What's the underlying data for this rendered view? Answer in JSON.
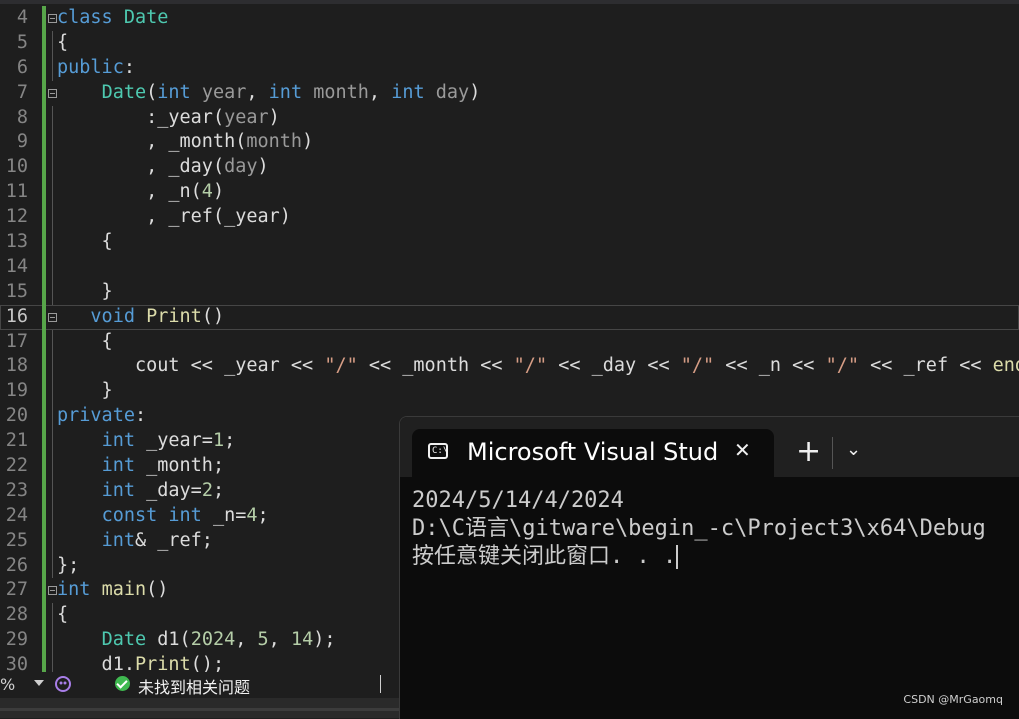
{
  "editor": {
    "active_line": "16",
    "lines": [
      {
        "n": "4",
        "tokens": [
          [
            "kw",
            "class "
          ],
          [
            "ty",
            "Date"
          ]
        ]
      },
      {
        "n": "5",
        "tokens": [
          [
            "pl",
            "{"
          ]
        ]
      },
      {
        "n": "6",
        "tokens": [
          [
            "kw",
            "public"
          ],
          [
            "pl",
            ":"
          ]
        ]
      },
      {
        "n": "7",
        "tokens": [
          [
            "pl",
            "    "
          ],
          [
            "ty",
            "Date"
          ],
          [
            "pl",
            "("
          ],
          [
            "kw",
            "int"
          ],
          [
            "pm",
            " year"
          ],
          [
            "pl",
            ", "
          ],
          [
            "kw",
            "int"
          ],
          [
            "pm",
            " month"
          ],
          [
            "pl",
            ", "
          ],
          [
            "kw",
            "int"
          ],
          [
            "pm",
            " day"
          ],
          [
            "pl",
            ")"
          ]
        ]
      },
      {
        "n": "8",
        "tokens": [
          [
            "pl",
            "        :_year"
          ],
          [
            "pl",
            "("
          ],
          [
            "pm",
            "year"
          ],
          [
            "pl",
            ")"
          ]
        ]
      },
      {
        "n": "9",
        "tokens": [
          [
            "pl",
            "        , _month"
          ],
          [
            "pl",
            "("
          ],
          [
            "pm",
            "month"
          ],
          [
            "pl",
            ")"
          ]
        ]
      },
      {
        "n": "10",
        "tokens": [
          [
            "pl",
            "        , _day"
          ],
          [
            "pl",
            "("
          ],
          [
            "pm",
            "day"
          ],
          [
            "pl",
            ")"
          ]
        ]
      },
      {
        "n": "11",
        "tokens": [
          [
            "pl",
            "        , _n"
          ],
          [
            "pl",
            "("
          ],
          [
            "nu",
            "4"
          ],
          [
            "pl",
            ")"
          ]
        ]
      },
      {
        "n": "12",
        "tokens": [
          [
            "pl",
            "        , _ref"
          ],
          [
            "pl",
            "(_year)"
          ]
        ]
      },
      {
        "n": "13",
        "tokens": [
          [
            "pl",
            "    {"
          ]
        ]
      },
      {
        "n": "14",
        "tokens": [
          [
            "pl",
            ""
          ]
        ]
      },
      {
        "n": "15",
        "tokens": [
          [
            "pl",
            "    }"
          ]
        ]
      },
      {
        "n": "16",
        "tokens": [
          [
            "pl",
            "   "
          ],
          [
            "kw",
            "void"
          ],
          [
            "pl",
            " "
          ],
          [
            "fn",
            "Print"
          ],
          [
            "pl",
            "()"
          ]
        ]
      },
      {
        "n": "17",
        "tokens": [
          [
            "pl",
            "    {"
          ]
        ]
      },
      {
        "n": "18",
        "tokens": [
          [
            "pl",
            "       cout << _year << "
          ],
          [
            "st",
            "\"/\""
          ],
          [
            "pl",
            " << _month << "
          ],
          [
            "st",
            "\"/\""
          ],
          [
            "pl",
            " << _day << "
          ],
          [
            "st",
            "\"/\""
          ],
          [
            "pl",
            " << _n << "
          ],
          [
            "st",
            "\"/\""
          ],
          [
            "pl",
            " << _ref << "
          ],
          [
            "fn",
            "endl"
          ],
          [
            "pl",
            ";"
          ]
        ]
      },
      {
        "n": "19",
        "tokens": [
          [
            "pl",
            "    }"
          ]
        ]
      },
      {
        "n": "20",
        "tokens": [
          [
            "kw",
            "private"
          ],
          [
            "pl",
            ":"
          ]
        ]
      },
      {
        "n": "21",
        "tokens": [
          [
            "pl",
            "    "
          ],
          [
            "kw",
            "int"
          ],
          [
            "pl",
            " _year="
          ],
          [
            "nu",
            "1"
          ],
          [
            "pl",
            ";"
          ]
        ]
      },
      {
        "n": "22",
        "tokens": [
          [
            "pl",
            "    "
          ],
          [
            "kw",
            "int"
          ],
          [
            "pl",
            " _month;"
          ]
        ]
      },
      {
        "n": "23",
        "tokens": [
          [
            "pl",
            "    "
          ],
          [
            "kw",
            "int"
          ],
          [
            "pl",
            " _day="
          ],
          [
            "nu",
            "2"
          ],
          [
            "pl",
            ";"
          ]
        ]
      },
      {
        "n": "24",
        "tokens": [
          [
            "pl",
            "    "
          ],
          [
            "kw",
            "const"
          ],
          [
            "pl",
            " "
          ],
          [
            "kw",
            "int"
          ],
          [
            "pl",
            " _n="
          ],
          [
            "nu",
            "4"
          ],
          [
            "pl",
            ";"
          ]
        ]
      },
      {
        "n": "25",
        "tokens": [
          [
            "pl",
            "    "
          ],
          [
            "kw",
            "int"
          ],
          [
            "pl",
            "& _ref;"
          ]
        ]
      },
      {
        "n": "26",
        "tokens": [
          [
            "pl",
            "};"
          ]
        ]
      },
      {
        "n": "27",
        "tokens": [
          [
            "kw",
            "int"
          ],
          [
            "pl",
            " "
          ],
          [
            "fn",
            "main"
          ],
          [
            "pl",
            "()"
          ]
        ]
      },
      {
        "n": "28",
        "tokens": [
          [
            "pl",
            "{"
          ]
        ]
      },
      {
        "n": "29",
        "tokens": [
          [
            "pl",
            "    "
          ],
          [
            "ty",
            "Date"
          ],
          [
            "pl",
            " d1("
          ],
          [
            "nu",
            "2024"
          ],
          [
            "pl",
            ", "
          ],
          [
            "nu",
            "5"
          ],
          [
            "pl",
            ", "
          ],
          [
            "nu",
            "14"
          ],
          [
            "pl",
            ");"
          ]
        ]
      },
      {
        "n": "30",
        "tokens": [
          [
            "pl",
            "    d1."
          ],
          [
            "fn",
            "Print"
          ],
          [
            "pl",
            "();"
          ]
        ]
      }
    ],
    "fold_lines": [
      "4",
      "7",
      "16",
      "27"
    ]
  },
  "statusbar": {
    "left_text": "%",
    "issues_text": "未找到相关问题"
  },
  "terminal": {
    "tab_title": "Microsoft Visual Stud",
    "icon_glyph": "C:\\",
    "close_glyph": "✕",
    "new_tab_glyph": "+",
    "dropdown_glyph": "⌄",
    "output_line1": "2024/5/14/4/2024",
    "output_line2": "",
    "output_line3": "D:\\C语言\\gitware\\begin_-c\\Project3\\x64\\Debug",
    "output_line4": "按任意键关闭此窗口. . ."
  },
  "watermark": "CSDN @MrGaomq",
  "colors": {
    "keyword": "#569cd6",
    "type": "#4ec9b0",
    "function": "#dcdcaa",
    "param": "#9a9a9a",
    "number": "#b5cea8",
    "string": "#d69d85",
    "plain": "#dcdcdc"
  }
}
